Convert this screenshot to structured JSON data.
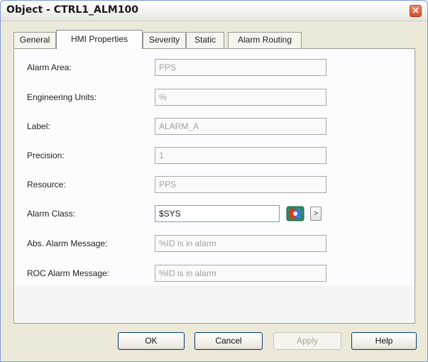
{
  "window": {
    "title": "Object - CTRL1_ALM100",
    "close_symbol": "✕"
  },
  "tabs": [
    {
      "label": "General"
    },
    {
      "label": "HMI Properties"
    },
    {
      "label": "Severity"
    },
    {
      "label": "Static"
    },
    {
      "label": "Alarm Routing"
    }
  ],
  "fields": [
    {
      "label": "Alarm Area:",
      "value": "PPS"
    },
    {
      "label": "Engineering Units:",
      "value": "%"
    },
    {
      "label": "Label:",
      "value": "ALARM_A"
    },
    {
      "label": "Precision:",
      "value": "1"
    },
    {
      "label": "Resource:",
      "value": "PPS"
    },
    {
      "label": "Alarm Class:",
      "value": "$SYS"
    },
    {
      "label": "Abs. Alarm Message:",
      "value": "%ID is in alarm"
    },
    {
      "label": "ROC Alarm Message:",
      "value": "%ID is in alarm"
    }
  ],
  "alarm_class_more": ">",
  "buttons": {
    "ok": "OK",
    "cancel": "Cancel",
    "apply": "Apply",
    "help": "Help"
  },
  "colors": {
    "title_bar": "#f2f2ee",
    "dialog_bg": "#ece9d8",
    "button_border": "#003c74",
    "disabled_text": "#aca899"
  }
}
